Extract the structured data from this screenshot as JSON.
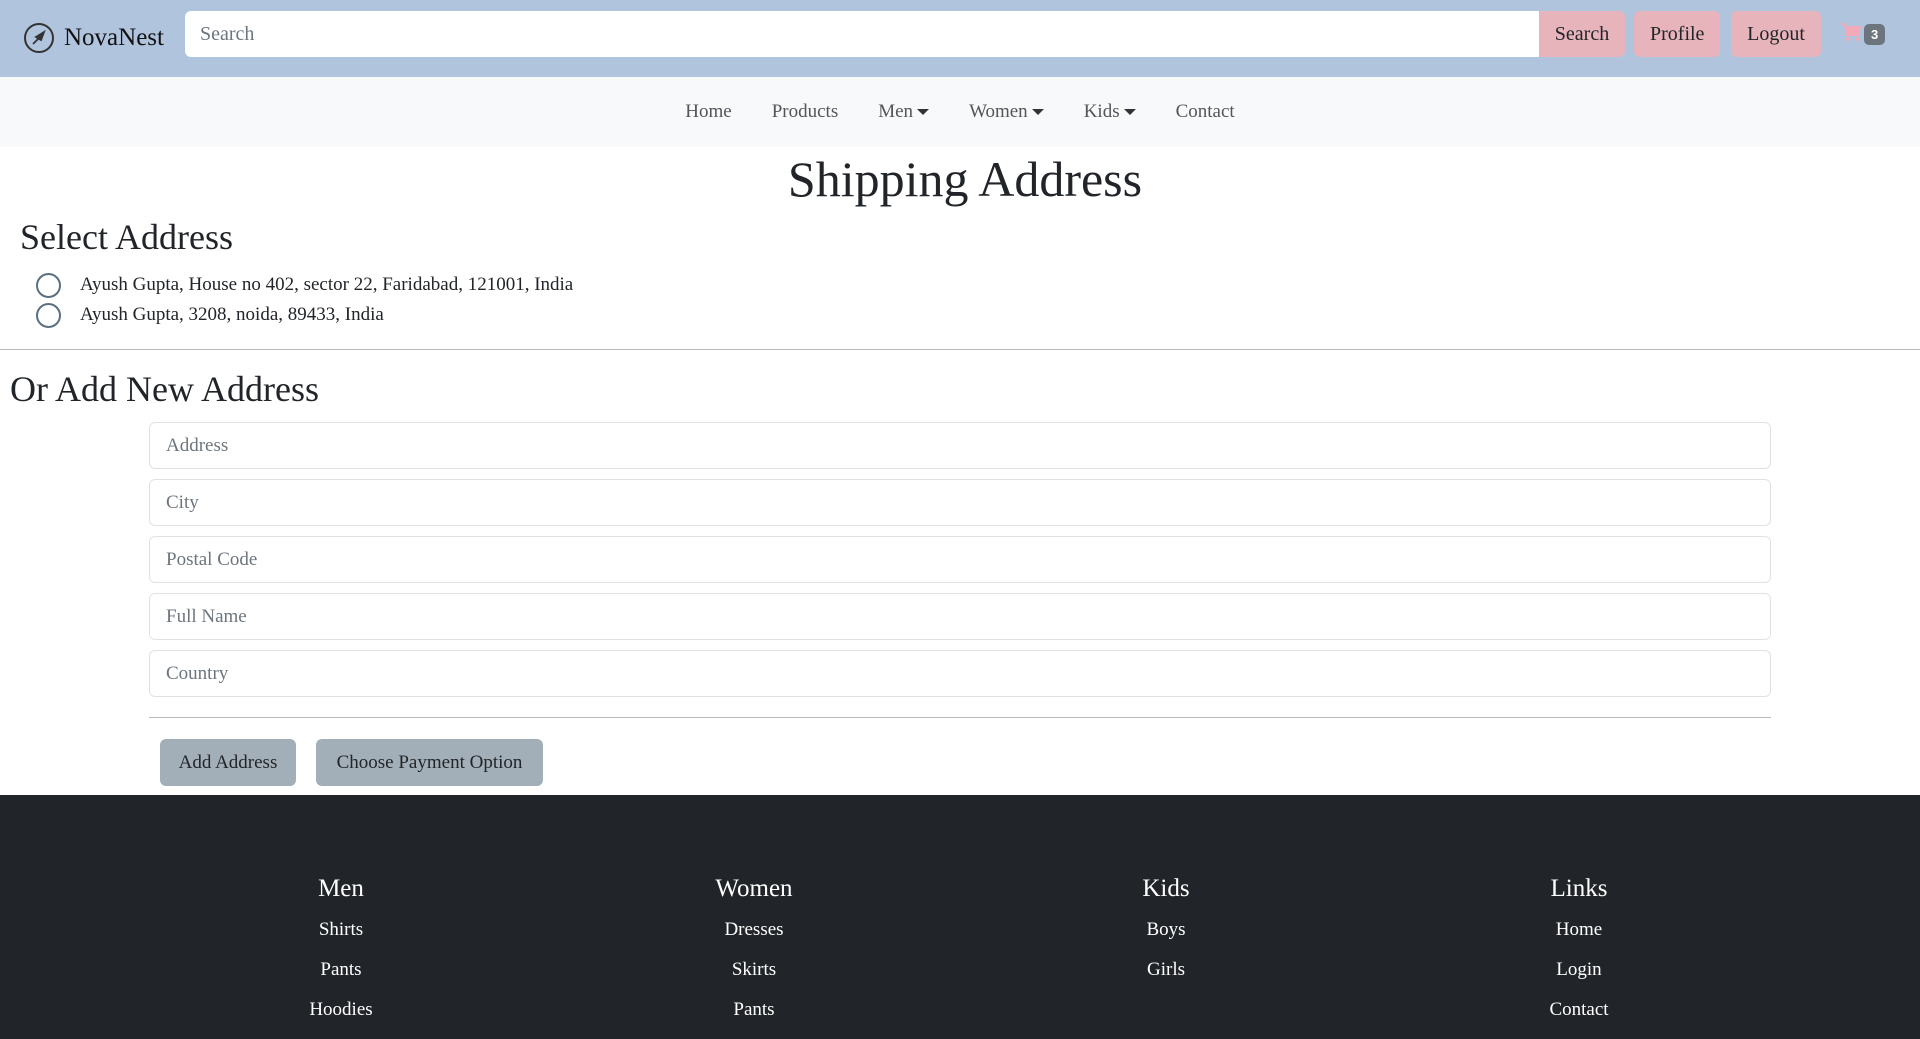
{
  "header": {
    "brand": "NovaNest",
    "search_placeholder": "Search",
    "search_button": "Search",
    "profile_button": "Profile",
    "logout_button": "Logout",
    "cart_count": "3"
  },
  "nav": {
    "items": [
      {
        "label": "Home"
      },
      {
        "label": "Products"
      },
      {
        "label": "Men"
      },
      {
        "label": "Women"
      },
      {
        "label": "Kids"
      },
      {
        "label": "Contact"
      }
    ]
  },
  "page": {
    "title": "Shipping Address",
    "select_title": "Select Address",
    "addresses": [
      "Ayush Gupta, House no 402, sector 22, Faridabad, 121001, India",
      "Ayush Gupta, 3208, noida, 89433, India"
    ],
    "new_title": "Or Add New Address",
    "fields": {
      "address": "Address",
      "city": "City",
      "postal": "Postal Code",
      "fullname": "Full Name",
      "country": "Country"
    },
    "add_button": "Add Address",
    "pay_button": "Choose Payment Option"
  },
  "footer": {
    "columns": [
      {
        "title": "Men",
        "links": [
          "Shirts",
          "Pants",
          "Hoodies"
        ]
      },
      {
        "title": "Women",
        "links": [
          "Dresses",
          "Skirts",
          "Pants"
        ]
      },
      {
        "title": "Kids",
        "links": [
          "Boys",
          "Girls"
        ]
      },
      {
        "title": "Links",
        "links": [
          "Home",
          "Login",
          "Contact"
        ]
      }
    ]
  },
  "colors": {
    "header_bg": "#b0c4de",
    "accent_button": "#e8b4bc",
    "form_button": "#a3afb8",
    "footer_bg": "#212529"
  }
}
